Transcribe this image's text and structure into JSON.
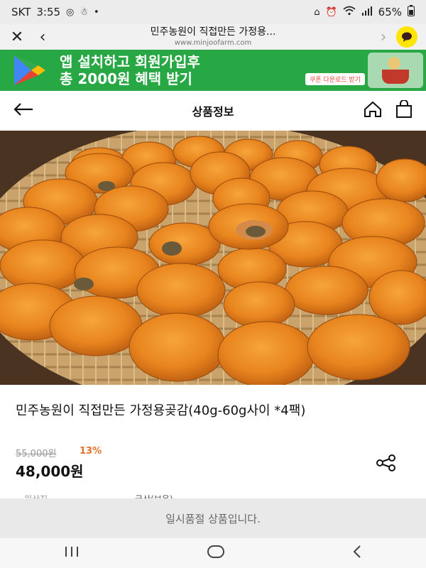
{
  "status_bar": {
    "carrier": "SKT",
    "time": "3:55",
    "battery": "65%",
    "icons": [
      "media-icon",
      "notification-icon",
      "alarm-icon",
      "wifi-icon",
      "signal-icon",
      "battery-icon"
    ]
  },
  "browser": {
    "page_title": "민주농원이 직접만든 가정용...",
    "url": "www.minjoofarm.com",
    "close_icon": "close-icon",
    "back_icon": "chevron-left-icon",
    "forward_icon": "chevron-right-icon",
    "kakao_icon": "kakaotalk-icon"
  },
  "banner": {
    "line1": "앱 설치하고 회원가입후",
    "line2": "총 2000원 혜택 받기",
    "cta": "쿠폰 다운로드 받기",
    "colors": {
      "bg": "#28a745",
      "cta_text": "#e84c3d"
    }
  },
  "header": {
    "title": "상품정보",
    "back_icon": "arrow-left-icon",
    "home_icon": "home-icon",
    "cart_icon": "shopping-bag-icon"
  },
  "product": {
    "image_subject": "dried-persimmons-in-basket",
    "name": "민주농원이 직접만든 가정용곶감(40g-60g사이 *4팩)",
    "original_price": "55,000원",
    "discount": "13%",
    "price": "48,000원",
    "share_icon": "share-icon",
    "partial_label": "원산지",
    "partial_value": "국산(보은)"
  },
  "sold_out": {
    "text": "일시품절 상품입니다."
  },
  "navbar": {
    "recent_icon": "recent-apps-icon",
    "home_icon": "home-circle-icon",
    "back_icon": "back-icon"
  },
  "colors": {
    "discount": "#e8702a",
    "persimmon": "#e8841e",
    "basket": "#c9a36b"
  }
}
